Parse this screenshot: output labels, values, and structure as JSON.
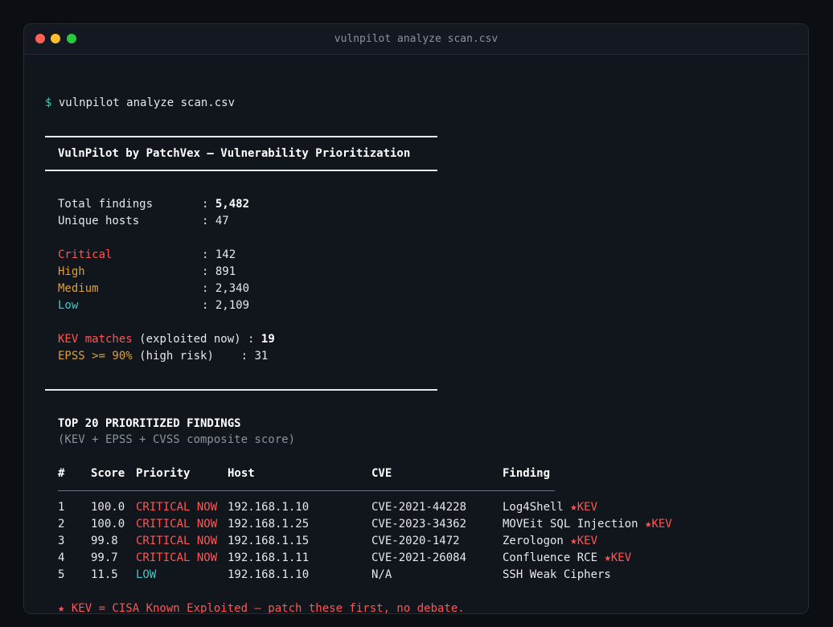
{
  "window": {
    "title": "vulnpilot analyze scan.csv"
  },
  "prompt": {
    "symbol": "$",
    "command": "vulnpilot analyze scan.csv"
  },
  "banner": {
    "title": "VulnPilot by PatchVex — Vulnerability Prioritization"
  },
  "summary": {
    "total_label": "Total findings",
    "total_value": "5,482",
    "hosts_label": "Unique hosts",
    "hosts_value": "47",
    "sep": ":",
    "critical_label": "Critical",
    "critical_value": "142",
    "high_label": "High",
    "high_value": "891",
    "medium_label": "Medium",
    "medium_value": "2,340",
    "low_label": "Low",
    "low_value": "2,109",
    "kev_label": "KEV matches",
    "kev_note": "(exploited now)",
    "kev_value": "19",
    "epss_label": "EPSS >= 90%",
    "epss_note": "(high risk)",
    "epss_value": "31"
  },
  "findings": {
    "heading": "TOP 20 PRIORITIZED FINDINGS",
    "subheading": "(KEV + EPSS + CVSS composite score)",
    "columns": [
      "#",
      "Score",
      "Priority",
      "Host",
      "CVE",
      "Finding"
    ],
    "rows": [
      {
        "num": "1",
        "score": "100.0",
        "priority": "CRITICAL NOW",
        "level": "crit",
        "host": "192.168.1.10",
        "cve": "CVE-2021-44228",
        "finding": "Log4Shell",
        "kev": "★KEV"
      },
      {
        "num": "2",
        "score": "100.0",
        "priority": "CRITICAL NOW",
        "level": "crit",
        "host": "192.168.1.25",
        "cve": "CVE-2023-34362",
        "finding": "MOVEit SQL Injection",
        "kev": "★KEV"
      },
      {
        "num": "3",
        "score": "99.8",
        "priority": "CRITICAL NOW",
        "level": "crit",
        "host": "192.168.1.15",
        "cve": "CVE-2020-1472",
        "finding": "Zerologon",
        "kev": "★KEV"
      },
      {
        "num": "4",
        "score": "99.7",
        "priority": "CRITICAL NOW",
        "level": "crit",
        "host": "192.168.1.11",
        "cve": "CVE-2021-26084",
        "finding": "Confluence RCE",
        "kev": "★KEV"
      },
      {
        "num": "5",
        "score": "11.5",
        "priority": "LOW",
        "level": "low",
        "host": "192.168.1.10",
        "cve": "N/A",
        "finding": "SSH Weak Ciphers",
        "kev": ""
      }
    ],
    "footnote": "★ KEV = CISA Known Exploited — patch these first, no debate."
  },
  "colors": {
    "critical": "#ff5555",
    "high": "#e0a030",
    "low": "#43c6c4",
    "prompt": "#43c6b4"
  }
}
